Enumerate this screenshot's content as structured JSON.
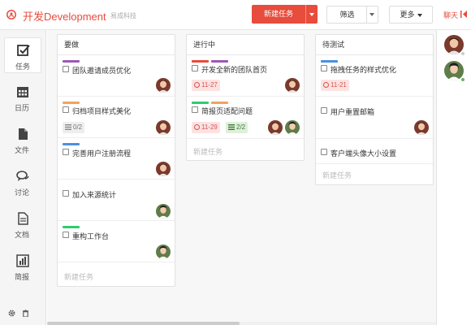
{
  "header": {
    "app_title": "开发Development",
    "company": "易成科技",
    "new_task_label": "新建任务",
    "filter_label": "筛选",
    "more_label": "更多",
    "chat_label": "聊天"
  },
  "sidebar": {
    "items": [
      {
        "label": "任务",
        "icon": "task-check-icon",
        "active": true
      },
      {
        "label": "日历",
        "icon": "calendar-icon"
      },
      {
        "label": "文件",
        "icon": "file-icon"
      },
      {
        "label": "讨论",
        "icon": "chat-bubble-icon"
      },
      {
        "label": "文档",
        "icon": "document-icon"
      },
      {
        "label": "简报",
        "icon": "bar-chart-icon"
      }
    ],
    "footer_icons": [
      "gear-icon",
      "trash-icon"
    ]
  },
  "board": {
    "columns": [
      {
        "title": "要做",
        "new_task_label": "新建任务",
        "tasks": [
          {
            "name": "团队邀请成员优化",
            "tags": [
              "#9b59b6"
            ],
            "avatar": "male"
          },
          {
            "name": "归档项目样式美化",
            "tags": [
              "#f0a35e"
            ],
            "subtasks": "0/2",
            "avatar": "male"
          },
          {
            "name": "完善用户注册流程",
            "tags": [
              "#4a90e2"
            ],
            "avatar": "male"
          },
          {
            "name": "加入来源统计",
            "tags": [],
            "avatar": "female"
          },
          {
            "name": "重构工作台",
            "tags": [
              "#2ecc71"
            ],
            "avatar": "female"
          }
        ]
      },
      {
        "title": "进行中",
        "new_task_label": "新建任务",
        "tasks": [
          {
            "name": "开发全新的团队首页",
            "tags": [
              "#e74c3c",
              "#9b59b6"
            ],
            "due": "11-27",
            "avatar": "male"
          },
          {
            "name": "简报页适配问题",
            "tags": [
              "#2ecc71",
              "#f0a35e"
            ],
            "due": "11-29",
            "subtasks": "2/2",
            "avatars": [
              "male",
              "female"
            ]
          }
        ]
      },
      {
        "title": "待测试",
        "new_task_label": "新建任务",
        "tasks": [
          {
            "name": "拖拽任务的样式优化",
            "tags": [
              "#4a90e2"
            ],
            "due": "11-21"
          },
          {
            "name": "用户重置邮箱",
            "tags": [],
            "avatar": "male"
          },
          {
            "name": "客户端头像大小设置",
            "tags": []
          }
        ]
      }
    ]
  },
  "colors": {
    "accent": "#e74c3c",
    "due_bg": "#fbe3e1",
    "subtask_done_bg": "#dff0d8",
    "online": "#5cb85c",
    "offline": "#cccccc"
  },
  "right_panel": {
    "members": [
      {
        "avatar": "male",
        "status": "offline"
      },
      {
        "avatar": "female",
        "status": "online"
      }
    ]
  }
}
